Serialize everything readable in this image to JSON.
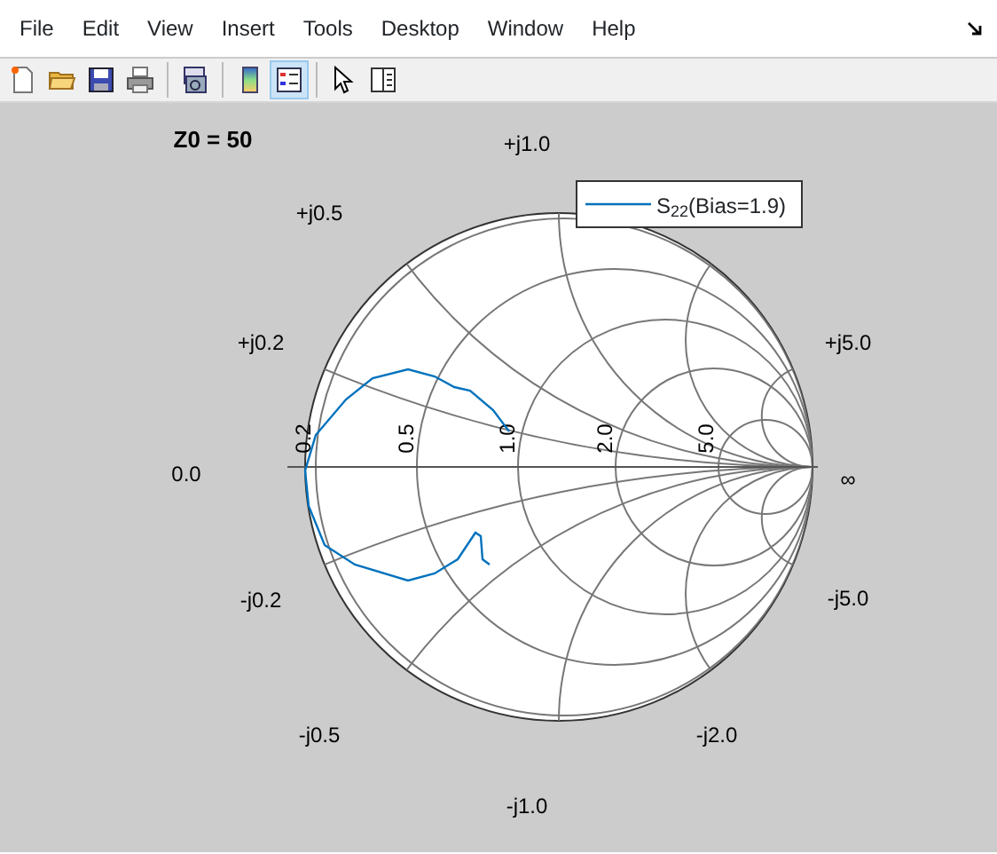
{
  "menu": [
    "File",
    "Edit",
    "View",
    "Insert",
    "Tools",
    "Desktop",
    "Window",
    "Help"
  ],
  "toolbar": [
    [
      {
        "selected": false
      },
      {
        "selected": false
      },
      {
        "selected": false
      },
      {
        "selected": false
      }
    ],
    [
      {
        "selected": false
      }
    ],
    [
      {
        "selected": false
      },
      {
        "selected": true
      }
    ],
    [
      {
        "selected": false
      },
      {
        "selected": false
      }
    ]
  ],
  "plot": {
    "title": "Z0 = 50",
    "reactance_labels": [
      "+j1.0",
      "+j0.5",
      "+j0.2",
      "+j5.0",
      "0.0",
      "∞",
      "-j0.2",
      "-j5.0",
      "-j0.5",
      "-j2.0",
      "-j1.0"
    ],
    "resistance_labels": [
      "0.2",
      "0.5",
      "1.0",
      "2.0",
      "5.0"
    ],
    "legend": {
      "label": "S$_{22}$(Bias=1.9)",
      "color": "#0072bd"
    }
  }
}
